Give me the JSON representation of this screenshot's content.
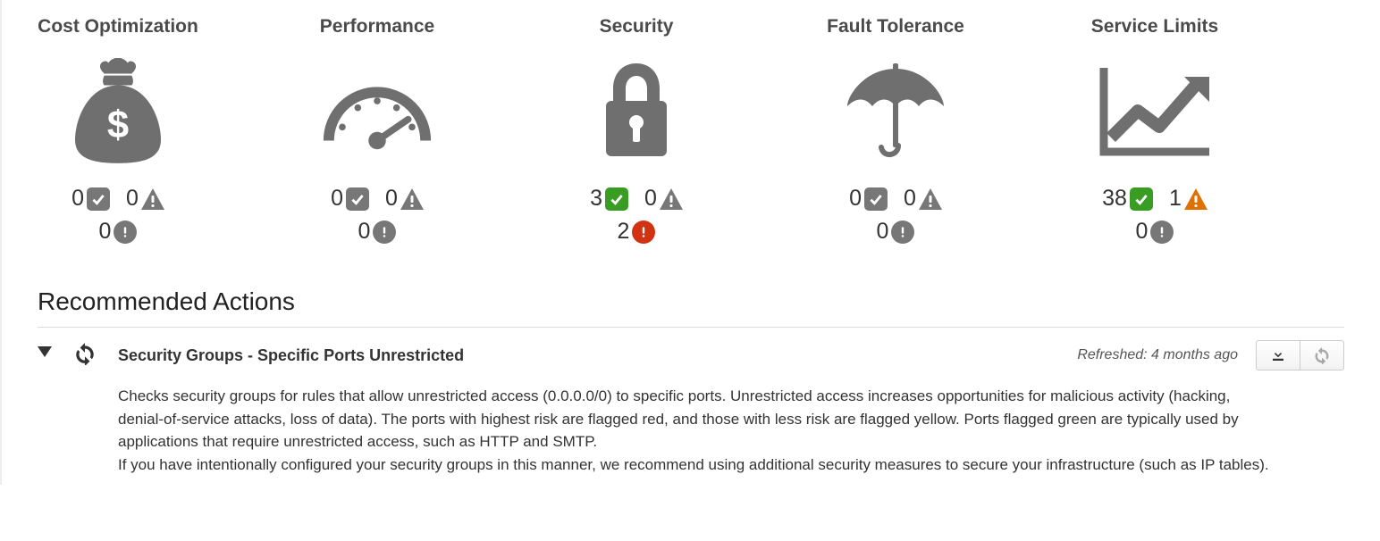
{
  "categories": [
    {
      "title": "Cost Optimization",
      "icon": "money-bag",
      "ok": 0,
      "warn": 0,
      "err": 0,
      "ok_color": "gray",
      "warn_color": "gray",
      "err_color": "gray"
    },
    {
      "title": "Performance",
      "icon": "gauge",
      "ok": 0,
      "warn": 0,
      "err": 0,
      "ok_color": "gray",
      "warn_color": "gray",
      "err_color": "gray"
    },
    {
      "title": "Security",
      "icon": "lock",
      "ok": 3,
      "warn": 0,
      "err": 2,
      "ok_color": "green",
      "warn_color": "gray",
      "err_color": "red"
    },
    {
      "title": "Fault Tolerance",
      "icon": "umbrella",
      "ok": 0,
      "warn": 0,
      "err": 0,
      "ok_color": "gray",
      "warn_color": "gray",
      "err_color": "gray"
    },
    {
      "title": "Service Limits",
      "icon": "chart-up",
      "ok": 38,
      "warn": 1,
      "err": 0,
      "ok_color": "green",
      "warn_color": "orange",
      "err_color": "gray"
    }
  ],
  "section_title": "Recommended Actions",
  "action": {
    "title": "Security Groups - Specific Ports Unrestricted",
    "refreshed": "Refreshed: 4 months ago",
    "para1": "Checks security groups for rules that allow unrestricted access (0.0.0.0/0) to specific ports. Unrestricted access increases opportunities for malicious activity (hacking, denial-of-service attacks, loss of data). The ports with highest risk are flagged red, and those with less risk are flagged yellow. Ports flagged green are typically used by applications that require unrestricted access, such as HTTP and SMTP.",
    "para2": "If you have intentionally configured your security groups in this manner, we recommend using additional security measures to secure your infrastructure (such as IP tables)."
  }
}
